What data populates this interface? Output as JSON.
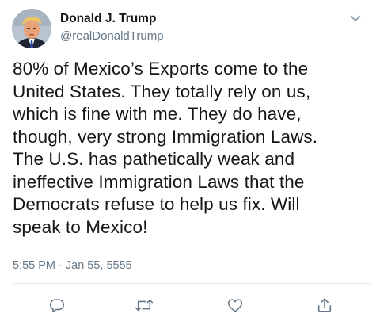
{
  "tweet": {
    "author": {
      "display_name": "Donald J. Trump",
      "handle": "@realDonaldTrump",
      "avatar_icon": "profile-photo"
    },
    "menu_icon": "chevron-down-icon",
    "text": "80% of Mexico’s Exports come to the\nUnited States. They totally rely on us,\nwhich is fine with me. They do have,\nthough, very strong Immigration Laws.\nThe U.S. has pathetically weak and\nineffective Immigration Laws that the\nDemocrats refuse to help us fix. Will\nspeak to Mexico!",
    "timestamp": "5:55 PM · Jan 55, 5555",
    "actions": [
      {
        "name": "reply",
        "icon": "comment-icon"
      },
      {
        "name": "retweet",
        "icon": "retweet-icon"
      },
      {
        "name": "like",
        "icon": "heart-icon"
      },
      {
        "name": "share",
        "icon": "share-icon"
      }
    ]
  },
  "colors": {
    "text_primary": "#14171a",
    "text_secondary": "#657786",
    "divider": "#e1e8ed",
    "icon": "#657786"
  }
}
